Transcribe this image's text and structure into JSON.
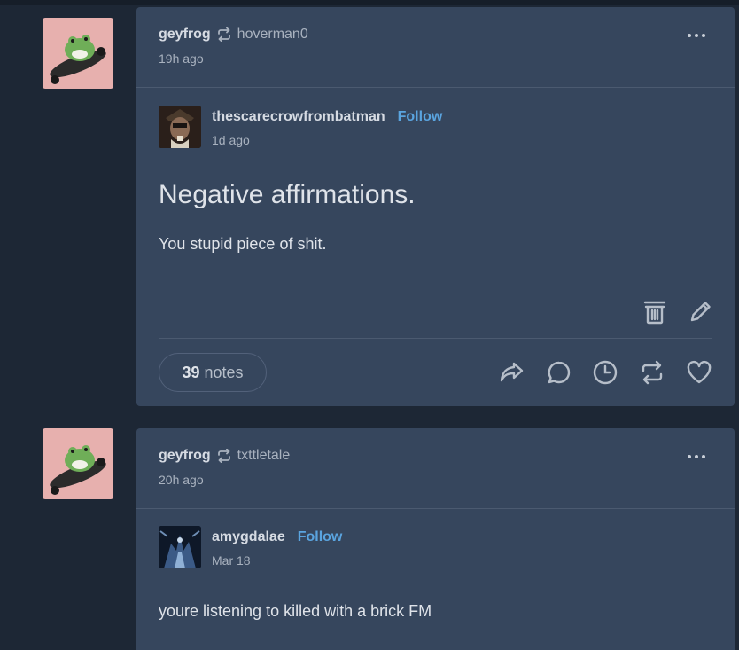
{
  "posts": [
    {
      "author": "geyfrog",
      "reblogged_from": "hoverman0",
      "time": "19h ago",
      "trail": {
        "author": "thescarecrowfrombatman",
        "follow_label": "Follow",
        "time": "1d ago",
        "heading": "Negative affirmations.",
        "body": "You stupid piece of shit."
      },
      "notes_count": "39",
      "notes_label": "notes"
    },
    {
      "author": "geyfrog",
      "reblogged_from": "txttletale",
      "time": "20h ago",
      "trail": {
        "author": "amygdalae",
        "follow_label": "Follow",
        "time": "Mar 18",
        "body": "youre listening to killed with a brick FM"
      }
    }
  ],
  "icons": [
    "reblog-icon",
    "more-options-icon",
    "delete-icon",
    "edit-icon",
    "share-icon",
    "reply-icon",
    "queue-icon",
    "reblog-icon",
    "like-icon"
  ],
  "colors": {
    "background": "#1d2735",
    "post": "#36465d",
    "link": "#5aa4df",
    "avatar_bg": "#e7b0ae"
  }
}
